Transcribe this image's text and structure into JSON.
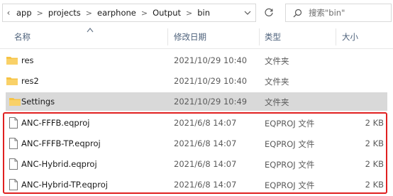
{
  "breadcrumb": {
    "lead_icon": "chevron-left-icon",
    "segments": [
      "app",
      "projects",
      "earphone",
      "Output",
      "bin"
    ],
    "separator": ">"
  },
  "search": {
    "placeholder": "搜索\"bin\""
  },
  "columns": {
    "name": "名称",
    "date": "修改日期",
    "type": "类型",
    "size": "大小"
  },
  "folders": [
    {
      "name": "res",
      "date": "2021/10/29 10:40",
      "type": "文件夹",
      "size": "",
      "icon": "folder-icon",
      "selected": false
    },
    {
      "name": "res2",
      "date": "2021/10/29 10:40",
      "type": "文件夹",
      "size": "",
      "icon": "folder-icon",
      "selected": false
    },
    {
      "name": "Settings",
      "date": "2021/10/29 10:49",
      "type": "文件夹",
      "size": "",
      "icon": "folder-icon",
      "selected": true
    }
  ],
  "files": [
    {
      "name": "ANC-FFFB.eqproj",
      "date": "2021/6/8 14:07",
      "type": "EQPROJ 文件",
      "size": "2 KB",
      "icon": "document-icon"
    },
    {
      "name": "ANC-FFFB-TP.eqproj",
      "date": "2021/6/8 14:07",
      "type": "EQPROJ 文件",
      "size": "2 KB",
      "icon": "document-icon"
    },
    {
      "name": "ANC-Hybrid.eqproj",
      "date": "2021/6/8 14:07",
      "type": "EQPROJ 文件",
      "size": "2 KB",
      "icon": "document-icon"
    },
    {
      "name": "ANC-Hybrid-TP.eqproj",
      "date": "2021/6/8 14:07",
      "type": "EQPROJ 文件",
      "size": "2 KB",
      "icon": "document-icon"
    }
  ],
  "colors": {
    "folder": "#f6c344",
    "selection": "#d9d9d9",
    "highlight_border": "#e02020",
    "header_text": "#4c607a"
  }
}
